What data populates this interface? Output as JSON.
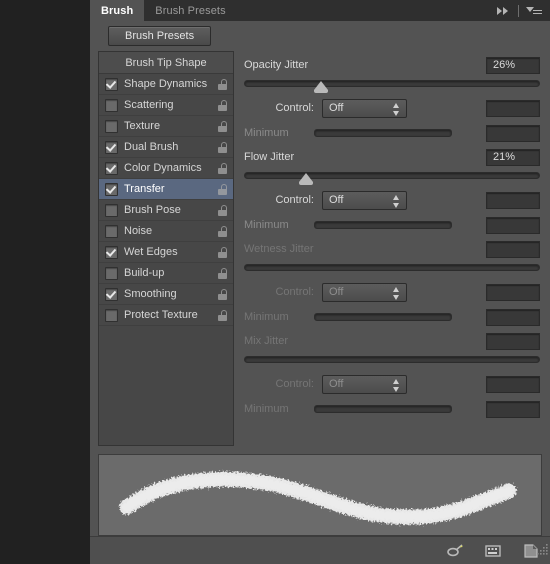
{
  "window": {
    "tabs": [
      {
        "label": "Brush",
        "active": true
      },
      {
        "label": "Brush Presets",
        "active": false
      }
    ],
    "collapse_icon": "double-chevron-right-icon",
    "menu_icon": "panel-menu-icon"
  },
  "toolbar": {
    "brush_presets_label": "Brush Presets"
  },
  "options_list": {
    "header": "Brush Tip Shape",
    "items": [
      {
        "label": "Shape Dynamics",
        "checked": true,
        "selected": false,
        "lock": "unlocked-padlock-icon"
      },
      {
        "label": "Scattering",
        "checked": false,
        "selected": false,
        "lock": "unlocked-padlock-icon"
      },
      {
        "label": "Texture",
        "checked": false,
        "selected": false,
        "lock": "unlocked-padlock-icon"
      },
      {
        "label": "Dual Brush",
        "checked": true,
        "selected": false,
        "lock": "unlocked-padlock-icon"
      },
      {
        "label": "Color Dynamics",
        "checked": true,
        "selected": false,
        "lock": "unlocked-padlock-icon"
      },
      {
        "label": "Transfer",
        "checked": true,
        "selected": true,
        "lock": "unlocked-padlock-icon"
      },
      {
        "label": "Brush Pose",
        "checked": false,
        "selected": false,
        "lock": "unlocked-padlock-icon"
      },
      {
        "label": "Noise",
        "checked": false,
        "selected": false,
        "lock": "unlocked-padlock-icon"
      },
      {
        "label": "Wet Edges",
        "checked": true,
        "selected": false,
        "lock": "unlocked-padlock-icon"
      },
      {
        "label": "Build-up",
        "checked": false,
        "selected": false,
        "lock": "unlocked-padlock-icon"
      },
      {
        "label": "Smoothing",
        "checked": true,
        "selected": false,
        "lock": "unlocked-padlock-icon"
      },
      {
        "label": "Protect Texture",
        "checked": false,
        "selected": false,
        "lock": "unlocked-padlock-icon"
      }
    ]
  },
  "sections": [
    {
      "title": "Opacity Jitter",
      "value": "26%",
      "slider_percent": 26,
      "enabled": true,
      "control_label": "Control:",
      "control_value": "Off",
      "control_extra_value": "",
      "minimum_label": "Minimum",
      "minimum_value": "",
      "minimum_enabled": false
    },
    {
      "title": "Flow Jitter",
      "value": "21%",
      "slider_percent": 21,
      "enabled": true,
      "control_label": "Control:",
      "control_value": "Off",
      "control_extra_value": "",
      "minimum_label": "Minimum",
      "minimum_value": "",
      "minimum_enabled": false
    },
    {
      "title": "Wetness Jitter",
      "value": "",
      "slider_percent": 0,
      "enabled": false,
      "control_label": "Control:",
      "control_value": "Off",
      "control_extra_value": "",
      "minimum_label": "Minimum",
      "minimum_value": "",
      "minimum_enabled": false
    },
    {
      "title": "Mix Jitter",
      "value": "",
      "slider_percent": 0,
      "enabled": false,
      "control_label": "Control:",
      "control_value": "Off",
      "control_extra_value": "",
      "minimum_label": "Minimum",
      "minimum_value": "",
      "minimum_enabled": false
    }
  ],
  "preview": {
    "name": "brush-stroke-preview",
    "stroke_color": "#e8e8e8",
    "background_color": "#6b6b6b"
  },
  "footer": {
    "icons": [
      {
        "name": "toggle-brush-panel-icon"
      },
      {
        "name": "new-brush-preset-icon"
      },
      {
        "name": "delete-brush-icon"
      }
    ]
  },
  "colors": {
    "panel_bg": "#535353",
    "list_bg": "#474747",
    "selection": "#5a6880",
    "text": "#d8d8d8",
    "text_disabled": "#757575"
  }
}
